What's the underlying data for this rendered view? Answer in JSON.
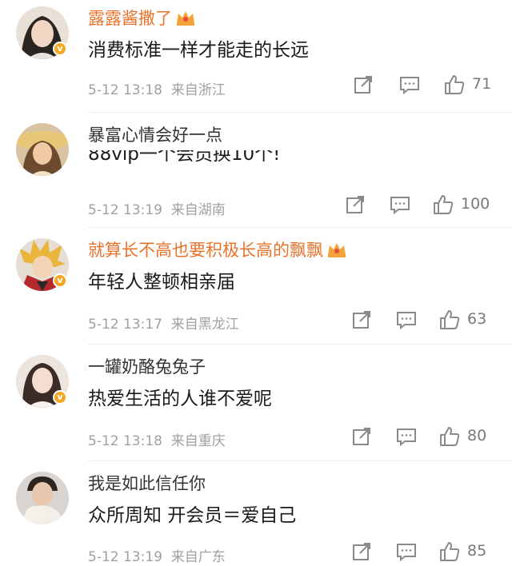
{
  "comments": [
    {
      "user": "露露酱撒了",
      "vip": true,
      "text": "消费标准一样才能走的长远",
      "date": "5-12 13:18",
      "location": "来自浙江",
      "likes": "71"
    },
    {
      "user": "暴富心情会好一点",
      "vip": false,
      "text": "88vip一个会员换10个!",
      "date": "5-12 13:19",
      "location": "来自湖南",
      "likes": "100"
    },
    {
      "user": "就算长不高也要积极长高的飘飘",
      "vip": true,
      "text": "年轻人整顿相亲届",
      "date": "5-12 13:17",
      "location": "来自黑龙江",
      "likes": "63"
    },
    {
      "user": "一罐奶酪兔兔子",
      "vip": false,
      "text": "热爱生活的人谁不爱呢",
      "date": "5-12 13:18",
      "location": "来自重庆",
      "likes": "80"
    },
    {
      "user": "我是如此信任你",
      "vip": false,
      "text": "众所周知 开会员＝爱自己",
      "date": "5-12 13:19",
      "location": "来自广东",
      "likes": "85"
    }
  ],
  "colors": {
    "vip_name": "#e8722a",
    "meta": "#a0a0a0",
    "icon": "#8a8a8a"
  },
  "icons": [
    "share-icon",
    "comment-icon",
    "like-icon",
    "crown-icon",
    "verified-badge-icon"
  ]
}
